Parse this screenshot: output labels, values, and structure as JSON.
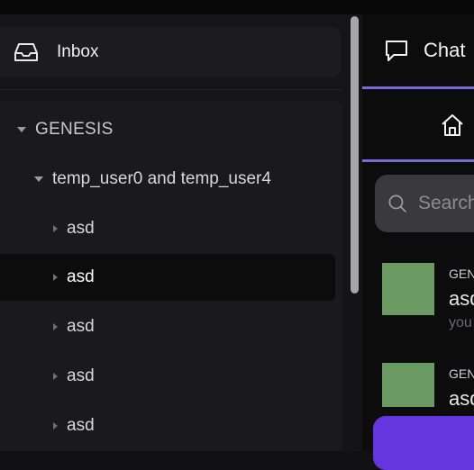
{
  "sidebar": {
    "inbox": {
      "label": "Inbox",
      "icon": "inbox-icon"
    },
    "tree": {
      "root": "GENESIS",
      "group": "temp_user0 and temp_user4",
      "items": [
        {
          "label": "asd",
          "selected": false
        },
        {
          "label": "asd",
          "selected": true
        },
        {
          "label": "asd",
          "selected": false
        },
        {
          "label": "asd",
          "selected": false
        },
        {
          "label": "asd",
          "selected": false
        }
      ]
    }
  },
  "panel": {
    "chat_tab": {
      "label": "Chat",
      "icon": "chat-bubble-icon"
    },
    "home_icon": "home-icon",
    "search": {
      "placeholder": "Search",
      "icon": "search-icon"
    },
    "messages": [
      {
        "channel": "GENESIS",
        "title": "asd",
        "preview": "you"
      },
      {
        "channel": "GENESIS",
        "title": "asd",
        "preview": ""
      }
    ]
  },
  "colors": {
    "accent": "#7a6ad8",
    "primary_button": "#6536e0",
    "avatar": "#6b9b63",
    "selected_row": "#0c0c0d"
  }
}
